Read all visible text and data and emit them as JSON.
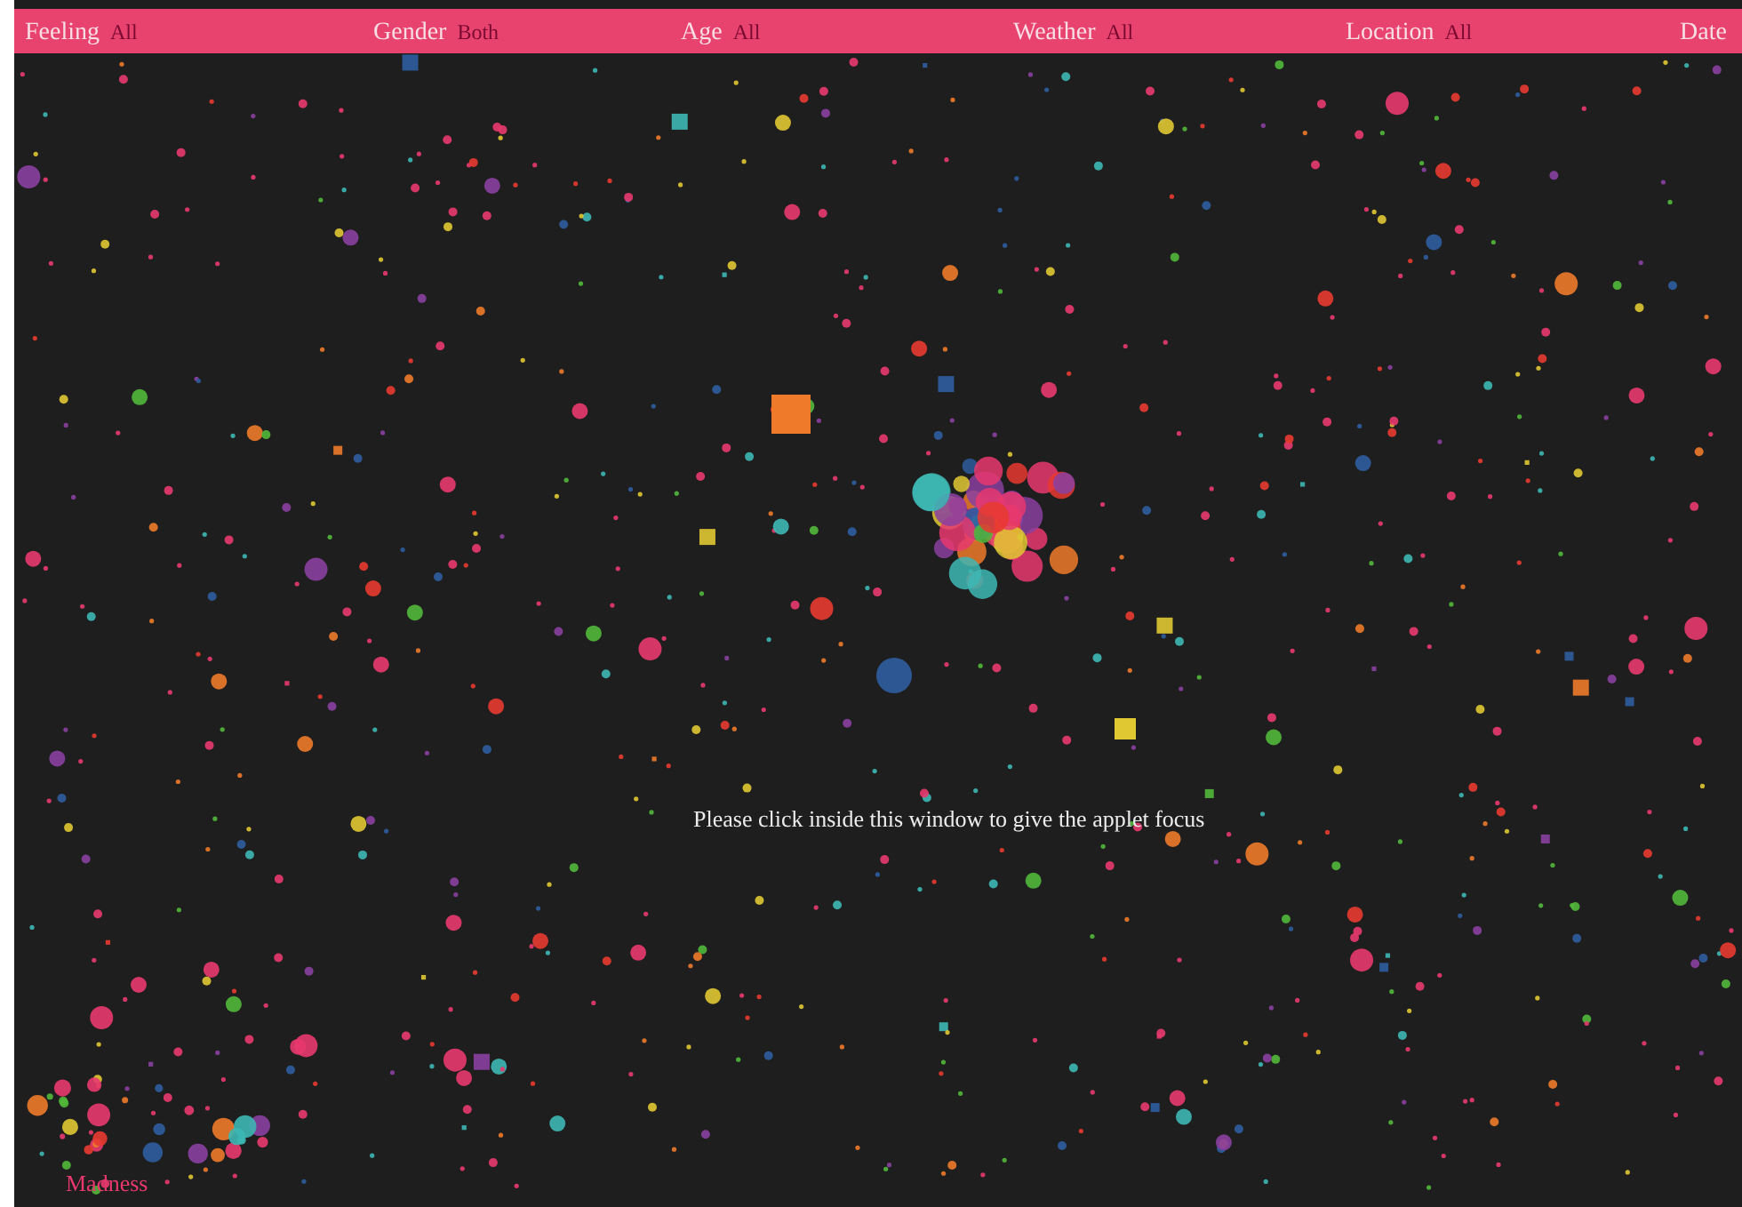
{
  "filters": [
    {
      "label": "Feeling",
      "value": "All"
    },
    {
      "label": "Gender",
      "value": "Both"
    },
    {
      "label": "Age",
      "value": "All"
    },
    {
      "label": "Weather",
      "value": "All"
    },
    {
      "label": "Location",
      "value": "All"
    },
    {
      "label": "Date"
    }
  ],
  "message": "Please click inside this window to give the applet focus",
  "cluster_label": "Madness"
}
